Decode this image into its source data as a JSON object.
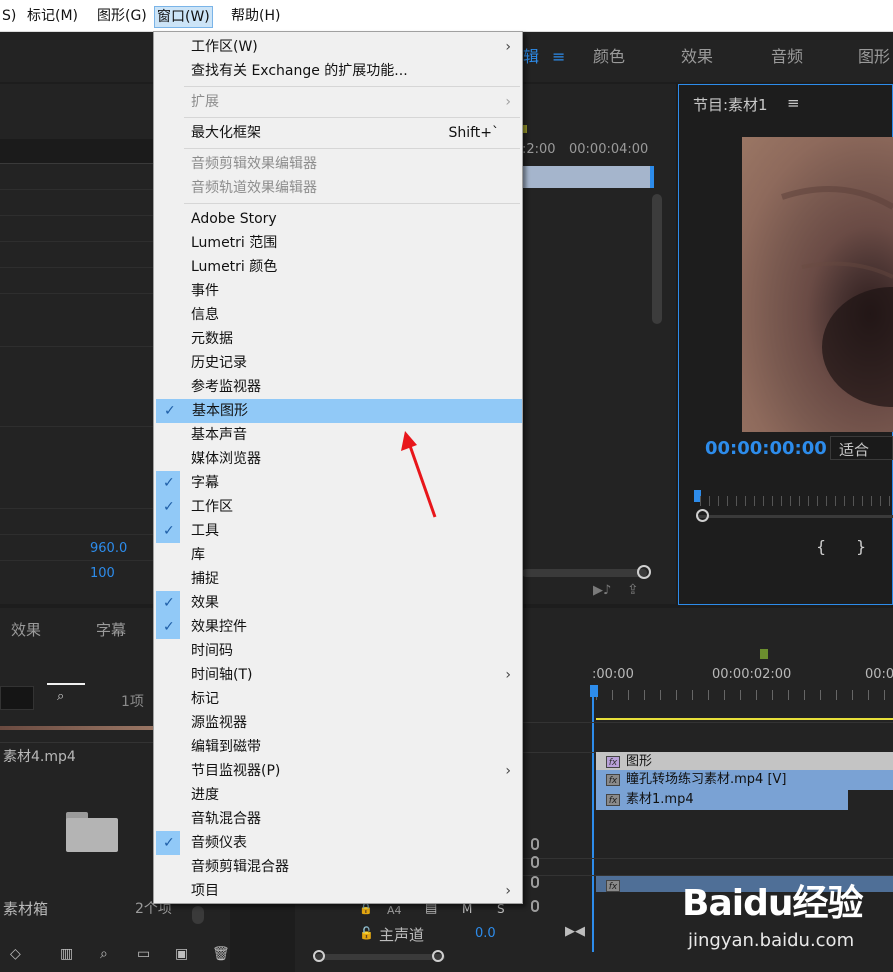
{
  "menubar": {
    "items": [
      "S)",
      "标记(M)",
      "图形(G)",
      "窗口(W)",
      "帮助(H)"
    ]
  },
  "workspace_tabs": [
    "辑",
    "颜色",
    "效果",
    "音频",
    "图形"
  ],
  "left_panel": {
    "value1": "960.0",
    "value2": "100"
  },
  "source_panel": {
    "time_partial": ":2:00",
    "time": "00:00:04:00"
  },
  "program_monitor": {
    "title": "节目:素材1",
    "timecode": "00:00:00:00",
    "fit": "适合"
  },
  "project_panel": {
    "tabs": [
      "效果",
      "字幕"
    ],
    "item_count": "1项",
    "file_name": "素材4.mp4",
    "bin_name": "素材箱",
    "bin_count": "2个项"
  },
  "timeline": {
    "time_start": ":00:00",
    "time_mid": "00:00:02:00",
    "time_end": "00:0",
    "clips": [
      "图形",
      "瞳孔转场练习素材.mp4 [V]",
      "素材1.mp4"
    ],
    "track_label": "A4",
    "master_label": "主声道",
    "master_value": "0.0"
  },
  "window_menu": {
    "items": [
      {
        "label": "工作区(W)",
        "submenu": true
      },
      {
        "label": "查找有关 Exchange 的扩展功能..."
      },
      {
        "label": "扩展",
        "disabled": true,
        "submenu": true
      },
      {
        "label": "最大化框架",
        "shortcut": "Shift+`"
      },
      {
        "label": "音频剪辑效果编辑器",
        "disabled": true
      },
      {
        "label": "音频轨道效果编辑器",
        "disabled": true
      },
      {
        "label": "Adobe Story"
      },
      {
        "label": "Lumetri 范围"
      },
      {
        "label": "Lumetri 颜色"
      },
      {
        "label": "事件"
      },
      {
        "label": "信息"
      },
      {
        "label": "元数据"
      },
      {
        "label": "历史记录"
      },
      {
        "label": "参考监视器"
      },
      {
        "label": "基本图形",
        "checked": true,
        "highlighted": true
      },
      {
        "label": "基本声音"
      },
      {
        "label": "媒体浏览器"
      },
      {
        "label": "字幕",
        "checked": true
      },
      {
        "label": "工作区",
        "checked": true
      },
      {
        "label": "工具",
        "checked": true
      },
      {
        "label": "库"
      },
      {
        "label": "捕捉"
      },
      {
        "label": "效果",
        "checked": true
      },
      {
        "label": "效果控件",
        "checked": true
      },
      {
        "label": "时间码"
      },
      {
        "label": "时间轴(T)",
        "submenu": true
      },
      {
        "label": "标记"
      },
      {
        "label": "源监视器"
      },
      {
        "label": "编辑到磁带"
      },
      {
        "label": "节目监视器(P)",
        "submenu": true
      },
      {
        "label": "进度"
      },
      {
        "label": "音轨混合器"
      },
      {
        "label": "音频仪表",
        "checked": true
      },
      {
        "label": "音频剪辑混合器"
      },
      {
        "label": "项目",
        "submenu": true
      }
    ]
  },
  "watermark": {
    "logo": "Baidu经验",
    "url": "jingyan.baidu.com"
  },
  "colors": {
    "accent_blue": "#2d8ceb",
    "menu_highlight": "#91c9f7",
    "arrow_red": "#e8161b",
    "timeline_yellow": "#e8e03a"
  }
}
